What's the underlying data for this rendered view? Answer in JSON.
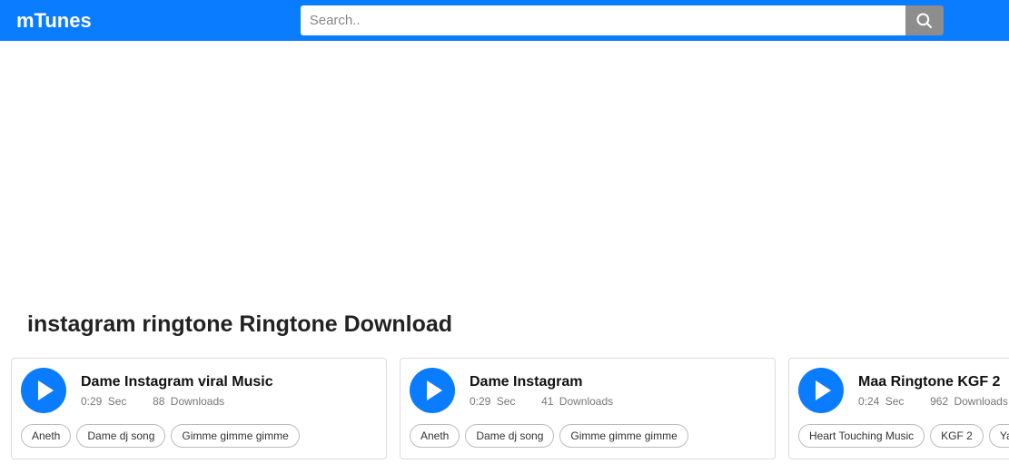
{
  "header": {
    "logo": "mTunes",
    "search_placeholder": "Search.."
  },
  "page_title": "instagram ringtone Ringtone Download",
  "labels": {
    "sec": "Sec",
    "downloads": "Downloads"
  },
  "cards": [
    {
      "title": "Dame Instagram viral Music",
      "duration": "0:29",
      "downloads": "88",
      "tags": [
        "Aneth",
        "Dame dj song",
        "Gimme gimme gimme"
      ]
    },
    {
      "title": "Dame Instagram",
      "duration": "0:29",
      "downloads": "41",
      "tags": [
        "Aneth",
        "Dame dj song",
        "Gimme gimme gimme"
      ]
    },
    {
      "title": "Maa Ringtone KGF 2",
      "duration": "0:24",
      "downloads": "962",
      "tags": [
        "Heart Touching Music",
        "KGF 2",
        "Yash"
      ]
    }
  ]
}
